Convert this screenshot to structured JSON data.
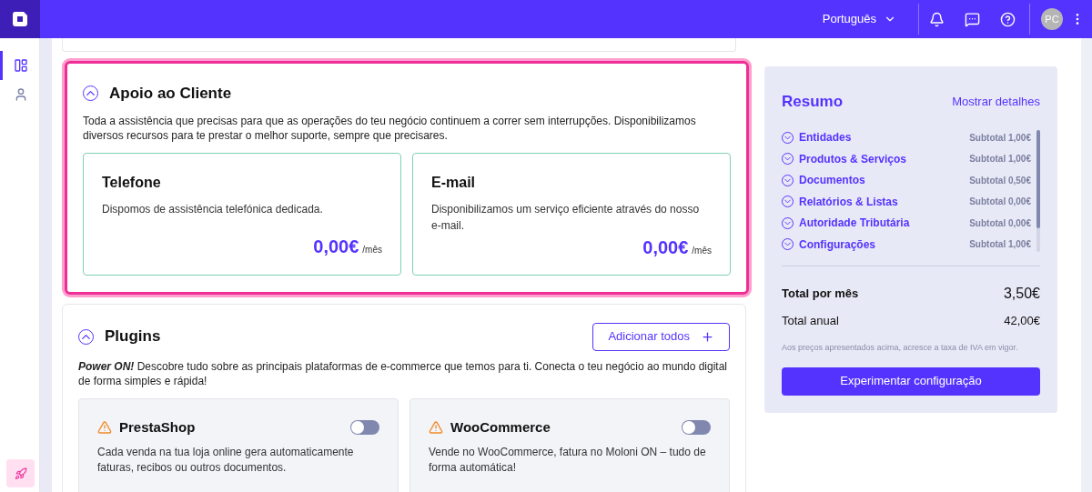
{
  "topbar": {
    "language": "Português",
    "avatar": "PC"
  },
  "sidebar": {
    "items": [
      {
        "selected": true
      },
      {
        "selected": false
      }
    ]
  },
  "sections": [
    {
      "title": "Apoio ao Cliente",
      "highlighted": true,
      "expanded": true,
      "intro": "Toda a assistência que precisas para que as operações do teu negócio continuem a correr sem interrupções. Disponibilizamos diversos recursos para te prestar o melhor suporte, sempre que precisares.",
      "cards": [
        {
          "kind": "service",
          "title": "Telefone",
          "description": "Dispomos de assistência telefónica dedicada.",
          "price": "0,00€",
          "unit": "/mês"
        },
        {
          "kind": "service",
          "title": "E-mail",
          "description": "Disponibilizamos um serviço eficiente através do nosso e-mail.",
          "price": "0,00€",
          "unit": "/mês"
        }
      ]
    },
    {
      "title": "Plugins",
      "highlighted": false,
      "expanded": true,
      "action": "Adicionar todos",
      "intro": "**Power ON!** Descobre tudo sobre as principais plataformas de e-commerce que temos para ti. Conecta o teu negócio ao mundo digital de forma simples e rápida!",
      "cards": [
        {
          "kind": "plugin",
          "title": "PrestaShop",
          "description": "Cada venda na tua loja online gera automaticamente faturas, recibos ou outros documentos.",
          "on": false
        },
        {
          "kind": "plugin",
          "title": "WooCommerce",
          "description": "Vende no WooCommerce, fatura no Moloni ON – tudo de forma automática!",
          "on": false
        }
      ]
    }
  ],
  "summary": {
    "title": "Resumo",
    "details_link": "Mostrar detalhes",
    "items": [
      {
        "name": "Entidades",
        "subtotal": "Subtotal 1,00€"
      },
      {
        "name": "Produtos & Serviços",
        "subtotal": "Subtotal 1,00€"
      },
      {
        "name": "Documentos",
        "subtotal": "Subtotal 0,50€"
      },
      {
        "name": "Relatórios & Listas",
        "subtotal": "Subtotal 0,00€"
      },
      {
        "name": "Autoridade Tributária",
        "subtotal": "Subtotal 0,00€"
      },
      {
        "name": "Configurações",
        "subtotal": "Subtotal 1,00€"
      }
    ],
    "monthly_label": "Total por mês",
    "monthly_value": "3,50€",
    "annual_label": "Total anual",
    "annual_value": "42,00€",
    "note": "Aos preços apresentados acima, acresce a taxa de IVA em vigor.",
    "button": "Experimentar configuração"
  }
}
